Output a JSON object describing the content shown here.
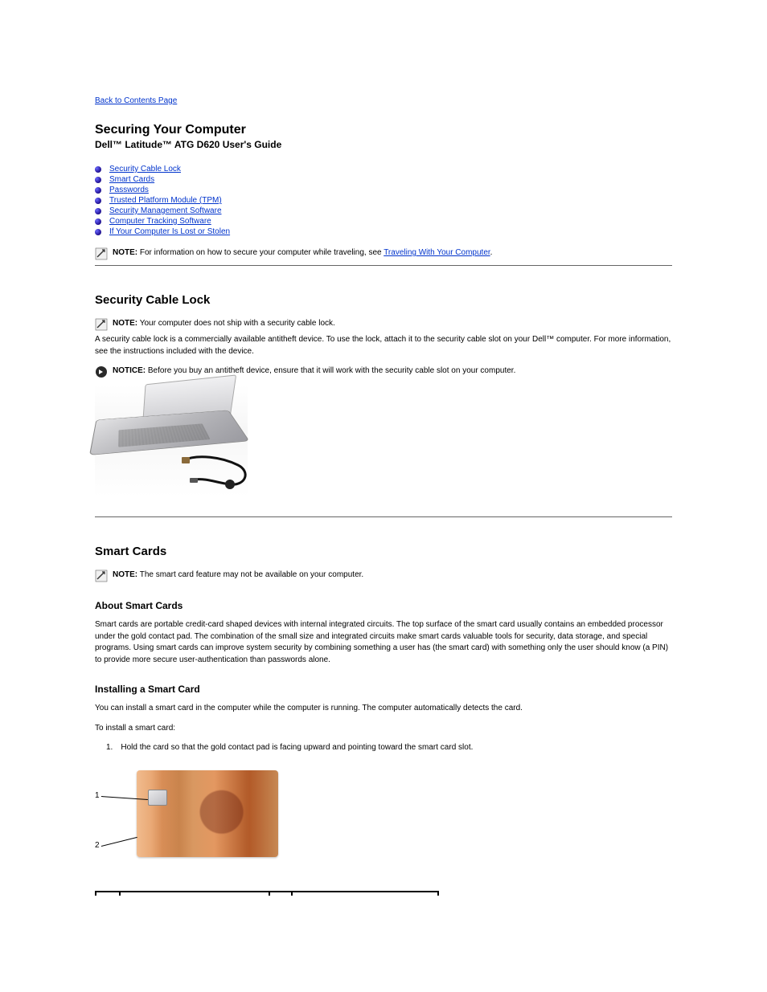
{
  "back_link": "Back to Contents Page",
  "title": "Securing Your Computer",
  "subtitle": "Dell™ Latitude™ ATG D620 User's Guide",
  "toc": [
    "Security Cable Lock",
    "Smart Cards",
    "Passwords",
    "Trusted Platform Module (TPM)",
    "Security Management Software",
    "Computer Tracking Software",
    "If Your Computer Is Lost or Stolen"
  ],
  "top_note_prefix": "NOTE:",
  "top_note_text": " For information on how to secure your computer while traveling, see ",
  "top_note_link": "Traveling With Your Computer",
  "top_note_suffix": ".",
  "sec_lock_heading": "Security Cable Lock",
  "sec_lock_note_prefix": "NOTE:",
  "sec_lock_note_text": " Your computer does not ship with a security cable lock.",
  "sec_lock_body": "A security cable lock is a commercially available antitheft device. To use the lock, attach it to the security cable slot on your Dell™ computer. For more information, see the instructions included with the device.",
  "sec_lock_notice_prefix": "NOTICE:",
  "sec_lock_notice_text": " Before you buy an antitheft device, ensure that it will work with the security cable slot on your computer.",
  "smart_heading": "Smart Cards",
  "smart_note_prefix": "NOTE:",
  "smart_note_text": " The smart card feature may not be available on your computer.",
  "about_heading": "About Smart Cards",
  "about_body": "Smart cards are portable credit-card shaped devices with internal integrated circuits. The top surface of the smart card usually contains an embedded processor under the gold contact pad. The combination of the small size and integrated circuits make smart cards valuable tools for security, data storage, and special programs. Using smart cards can improve system security by combining something a user has (the smart card) with something only the user should know (a PIN) to provide more secure user-authentication than passwords alone.",
  "install_heading": "Installing a Smart Card",
  "install_body": "You can install a smart card in the computer while the computer is running. The computer automatically detects the card.",
  "install_steps_intro": "To install a smart card:",
  "install_step1_num": "1.",
  "install_step1_text": "Hold the card so that the gold contact pad is facing upward and pointing toward the smart card slot.",
  "callout1": "1",
  "callout2": "2"
}
